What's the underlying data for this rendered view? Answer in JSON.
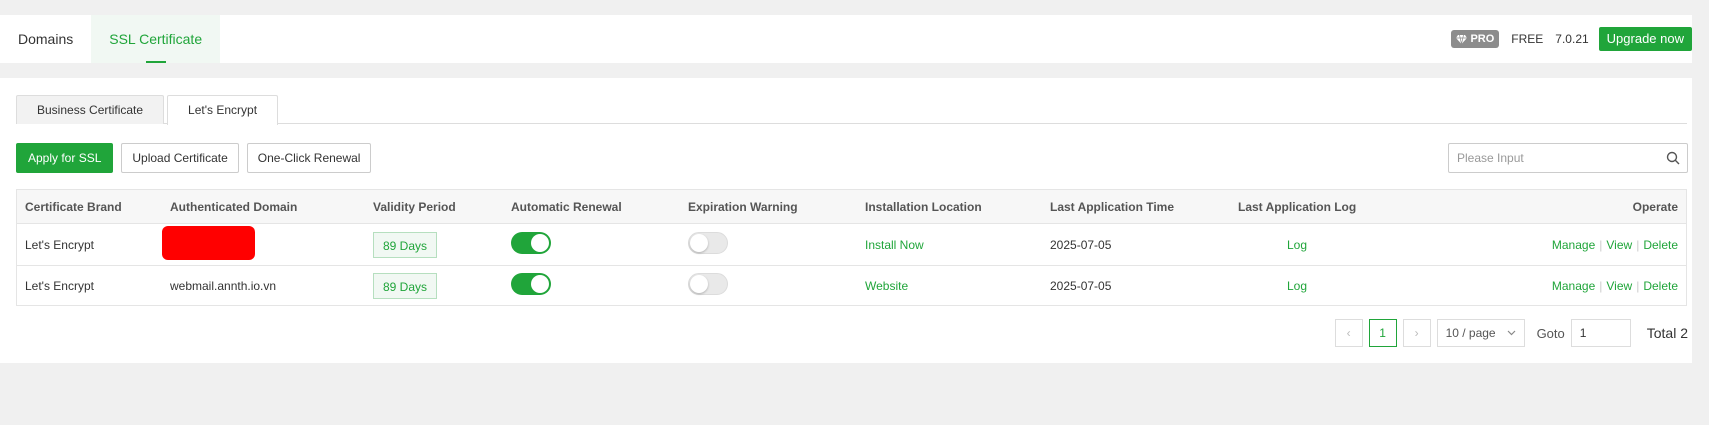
{
  "topnav": {
    "items": [
      {
        "label": "Domains",
        "active": false
      },
      {
        "label": "SSL Certificate",
        "active": true
      }
    ]
  },
  "header_right": {
    "pro_badge": "PRO",
    "free_label": "FREE",
    "version": "7.0.21",
    "upgrade_label": "Upgrade now"
  },
  "subtabs": [
    {
      "label": "Business Certificate",
      "active": false
    },
    {
      "label": "Let's Encrypt",
      "active": true
    }
  ],
  "toolbar": {
    "apply_label": "Apply for SSL",
    "upload_label": "Upload Certificate",
    "renewal_label": "One-Click Renewal",
    "search_placeholder": "Please Input",
    "search_value": ""
  },
  "table": {
    "columns": [
      "Certificate Brand",
      "Authenticated Domain",
      "Validity Period",
      "Automatic Renewal",
      "Expiration Warning",
      "Installation Location",
      "Last Application Time",
      "Last Application Log",
      "Operate"
    ],
    "rows": [
      {
        "brand": "Let's Encrypt",
        "domain": "",
        "domain_redacted": true,
        "validity": "89 Days",
        "auto_renewal": true,
        "expiration_warning": false,
        "location": "Install Now",
        "last_time": "2025-07-05",
        "log": "Log",
        "ops": [
          "Manage",
          "View",
          "Delete"
        ]
      },
      {
        "brand": "Let's Encrypt",
        "domain": "webmail.annth.io.vn",
        "domain_redacted": false,
        "validity": "89 Days",
        "auto_renewal": true,
        "expiration_warning": false,
        "location": "Website",
        "last_time": "2025-07-05",
        "log": "Log",
        "ops": [
          "Manage",
          "View",
          "Delete"
        ]
      }
    ]
  },
  "pagination": {
    "prev": "‹",
    "current_page": "1",
    "next": "›",
    "page_size": "10 / page",
    "goto_label": "Goto",
    "goto_value": "1",
    "total": "Total 2"
  },
  "colors": {
    "accent": "#20a53a",
    "redaction": "#ff0000"
  }
}
